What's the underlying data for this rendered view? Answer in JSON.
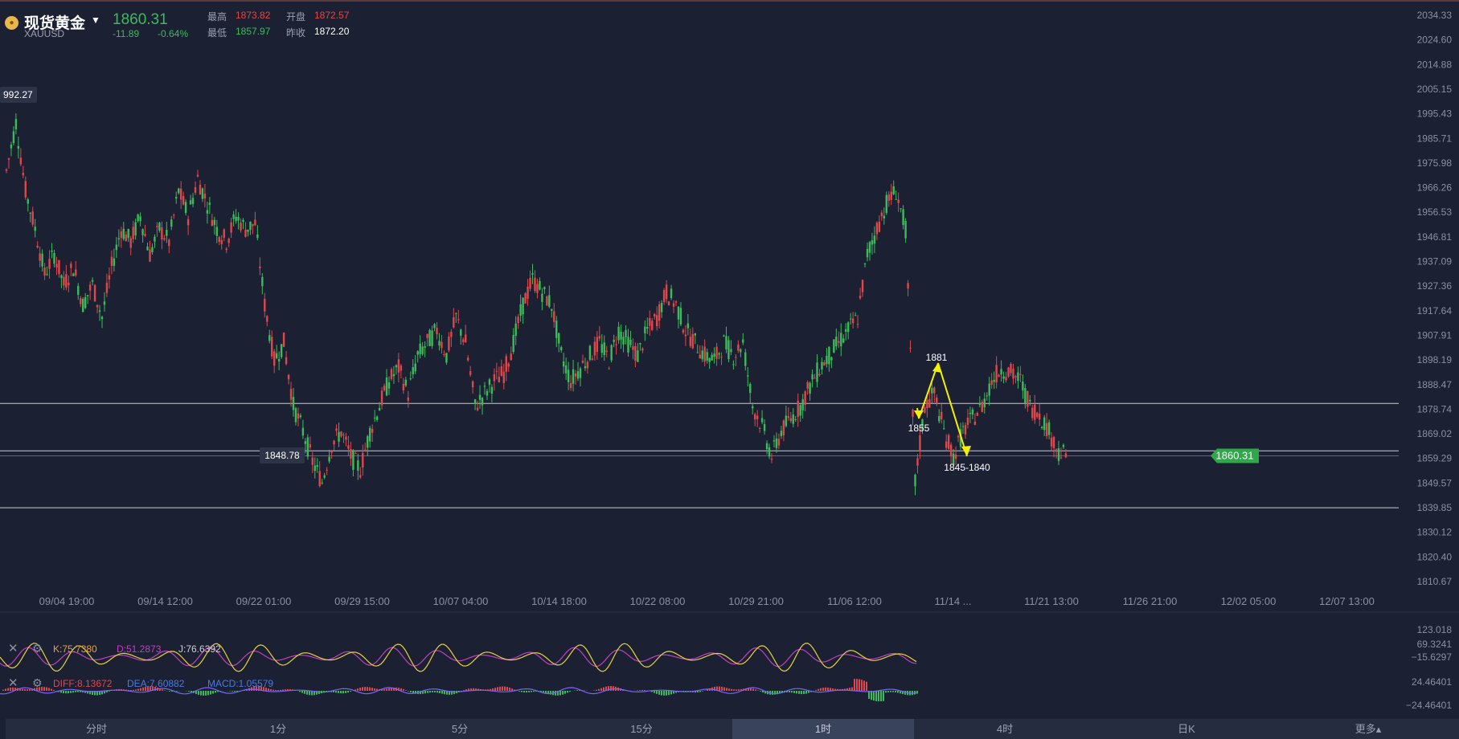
{
  "instrument": {
    "name": "现货黄金",
    "symbol": "XAUUSD",
    "last": "1860.31",
    "change": "-11.89",
    "change_pct": "-0.64%",
    "high_label": "最高",
    "high": "1873.82",
    "open_label": "开盘",
    "open": "1872.57",
    "low_label": "最低",
    "low": "1857.97",
    "prev_label": "昨收",
    "prev_close": "1872.20"
  },
  "chart_data": {
    "type": "candlestick",
    "price_axis_ticks": [
      "2034.33",
      "2024.60",
      "2014.88",
      "2005.15",
      "1995.43",
      "1985.71",
      "1975.98",
      "1966.26",
      "1956.53",
      "1946.81",
      "1937.09",
      "1927.36",
      "1917.64",
      "1907.91",
      "1898.19",
      "1888.47",
      "1878.74",
      "1869.02",
      "1859.29",
      "1849.57",
      "1839.85",
      "1830.12",
      "1820.40",
      "1810.67"
    ],
    "time_axis_ticks": [
      "09/04 19:00",
      "09/14 12:00",
      "09/22 01:00",
      "09/29 15:00",
      "10/07 04:00",
      "10/14 18:00",
      "10/22 08:00",
      "10/29 21:00",
      "11/06 12:00",
      "11/14 ...",
      "11/21 13:00",
      "11/26 21:00",
      "12/02 05:00",
      "12/07 13:00"
    ],
    "current_price_tag": "1860.31",
    "high_callout": "992.27",
    "low_callout": "1848.78",
    "horizontal_levels": [
      1881,
      1862.3,
      1839.8
    ],
    "projection": [
      {
        "label": "1881",
        "price": 1881
      },
      {
        "label": "1855",
        "price": 1855
      },
      {
        "label": "1845-1840",
        "price": 1840
      }
    ],
    "price_path": [
      [
        0,
        1973
      ],
      [
        1,
        1992
      ],
      [
        2,
        1965
      ],
      [
        3,
        1950
      ],
      [
        4,
        1932
      ],
      [
        5,
        1940
      ],
      [
        6,
        1928
      ],
      [
        7,
        1935
      ],
      [
        8,
        1920
      ],
      [
        9,
        1928
      ],
      [
        10,
        1915
      ],
      [
        11,
        1935
      ],
      [
        12,
        1950
      ],
      [
        13,
        1945
      ],
      [
        14,
        1955
      ],
      [
        15,
        1940
      ],
      [
        16,
        1950
      ],
      [
        17,
        1945
      ],
      [
        18,
        1965
      ],
      [
        19,
        1955
      ],
      [
        20,
        1970
      ],
      [
        21,
        1960
      ],
      [
        22,
        1950
      ],
      [
        23,
        1945
      ],
      [
        24,
        1955
      ],
      [
        25,
        1950
      ],
      [
        26,
        1952
      ],
      [
        27,
        1920
      ],
      [
        28,
        1898
      ],
      [
        29,
        1905
      ],
      [
        30,
        1880
      ],
      [
        31,
        1870
      ],
      [
        32,
        1858
      ],
      [
        33,
        1850
      ],
      [
        34,
        1865
      ],
      [
        35,
        1870
      ],
      [
        36,
        1860
      ],
      [
        37,
        1855
      ],
      [
        38,
        1870
      ],
      [
        39,
        1880
      ],
      [
        40,
        1890
      ],
      [
        41,
        1895
      ],
      [
        42,
        1885
      ],
      [
        43,
        1900
      ],
      [
        44,
        1905
      ],
      [
        45,
        1910
      ],
      [
        46,
        1900
      ],
      [
        47,
        1915
      ],
      [
        48,
        1905
      ],
      [
        49,
        1880
      ],
      [
        50,
        1885
      ],
      [
        51,
        1890
      ],
      [
        52,
        1893
      ],
      [
        53,
        1905
      ],
      [
        54,
        1920
      ],
      [
        55,
        1930
      ],
      [
        56,
        1925
      ],
      [
        57,
        1920
      ],
      [
        58,
        1900
      ],
      [
        59,
        1890
      ],
      [
        60,
        1895
      ],
      [
        61,
        1900
      ],
      [
        62,
        1905
      ],
      [
        63,
        1898
      ],
      [
        64,
        1910
      ],
      [
        65,
        1905
      ],
      [
        66,
        1900
      ],
      [
        67,
        1910
      ],
      [
        68,
        1915
      ],
      [
        69,
        1925
      ],
      [
        70,
        1920
      ],
      [
        71,
        1910
      ],
      [
        72,
        1905
      ],
      [
        73,
        1900
      ],
      [
        74,
        1898
      ],
      [
        75,
        1905
      ],
      [
        76,
        1900
      ],
      [
        77,
        1905
      ],
      [
        78,
        1880
      ],
      [
        79,
        1872
      ],
      [
        80,
        1860
      ],
      [
        81,
        1870
      ],
      [
        82,
        1875
      ],
      [
        83,
        1880
      ],
      [
        84,
        1888
      ],
      [
        85,
        1895
      ],
      [
        86,
        1900
      ],
      [
        87,
        1905
      ],
      [
        88,
        1910
      ],
      [
        89,
        1915
      ],
      [
        90,
        1940
      ],
      [
        91,
        1950
      ],
      [
        92,
        1960
      ],
      [
        93,
        1965
      ],
      [
        94,
        1950
      ],
      [
        95,
        1850
      ],
      [
        96,
        1880
      ],
      [
        97,
        1885
      ],
      [
        98,
        1870
      ],
      [
        99,
        1860
      ],
      [
        100,
        1870
      ],
      [
        101,
        1875
      ],
      [
        102,
        1880
      ],
      [
        103,
        1890
      ],
      [
        104,
        1895
      ],
      [
        105,
        1893
      ],
      [
        106,
        1890
      ],
      [
        107,
        1880
      ],
      [
        108,
        1877
      ],
      [
        109,
        1870
      ],
      [
        110,
        1862
      ],
      [
        111,
        1860
      ]
    ],
    "indicator1": {
      "k_label": "K:75.7380",
      "d_label": "D:51.2873",
      "j_label": "J:76.6392",
      "ticks": [
        "123.018",
        "69.3241",
        "−15.6297"
      ]
    },
    "indicator2": {
      "diff_label": "DIFF:8.13672",
      "dea_label": "DEA:7.60882",
      "macd_label": "MACD:1.05579",
      "ticks": [
        "24.46401",
        "−24.46401"
      ]
    }
  },
  "colors": {
    "up": "#e0474b",
    "down": "#3dbb5a",
    "background": "#1b2133",
    "projection": "#f5f000"
  },
  "tabs": [
    {
      "label": "分时"
    },
    {
      "label": "1分"
    },
    {
      "label": "5分"
    },
    {
      "label": "15分"
    },
    {
      "label": "1时"
    },
    {
      "label": "4时"
    },
    {
      "label": "日K"
    },
    {
      "label": "更多▴"
    }
  ],
  "active_tab": "1时"
}
